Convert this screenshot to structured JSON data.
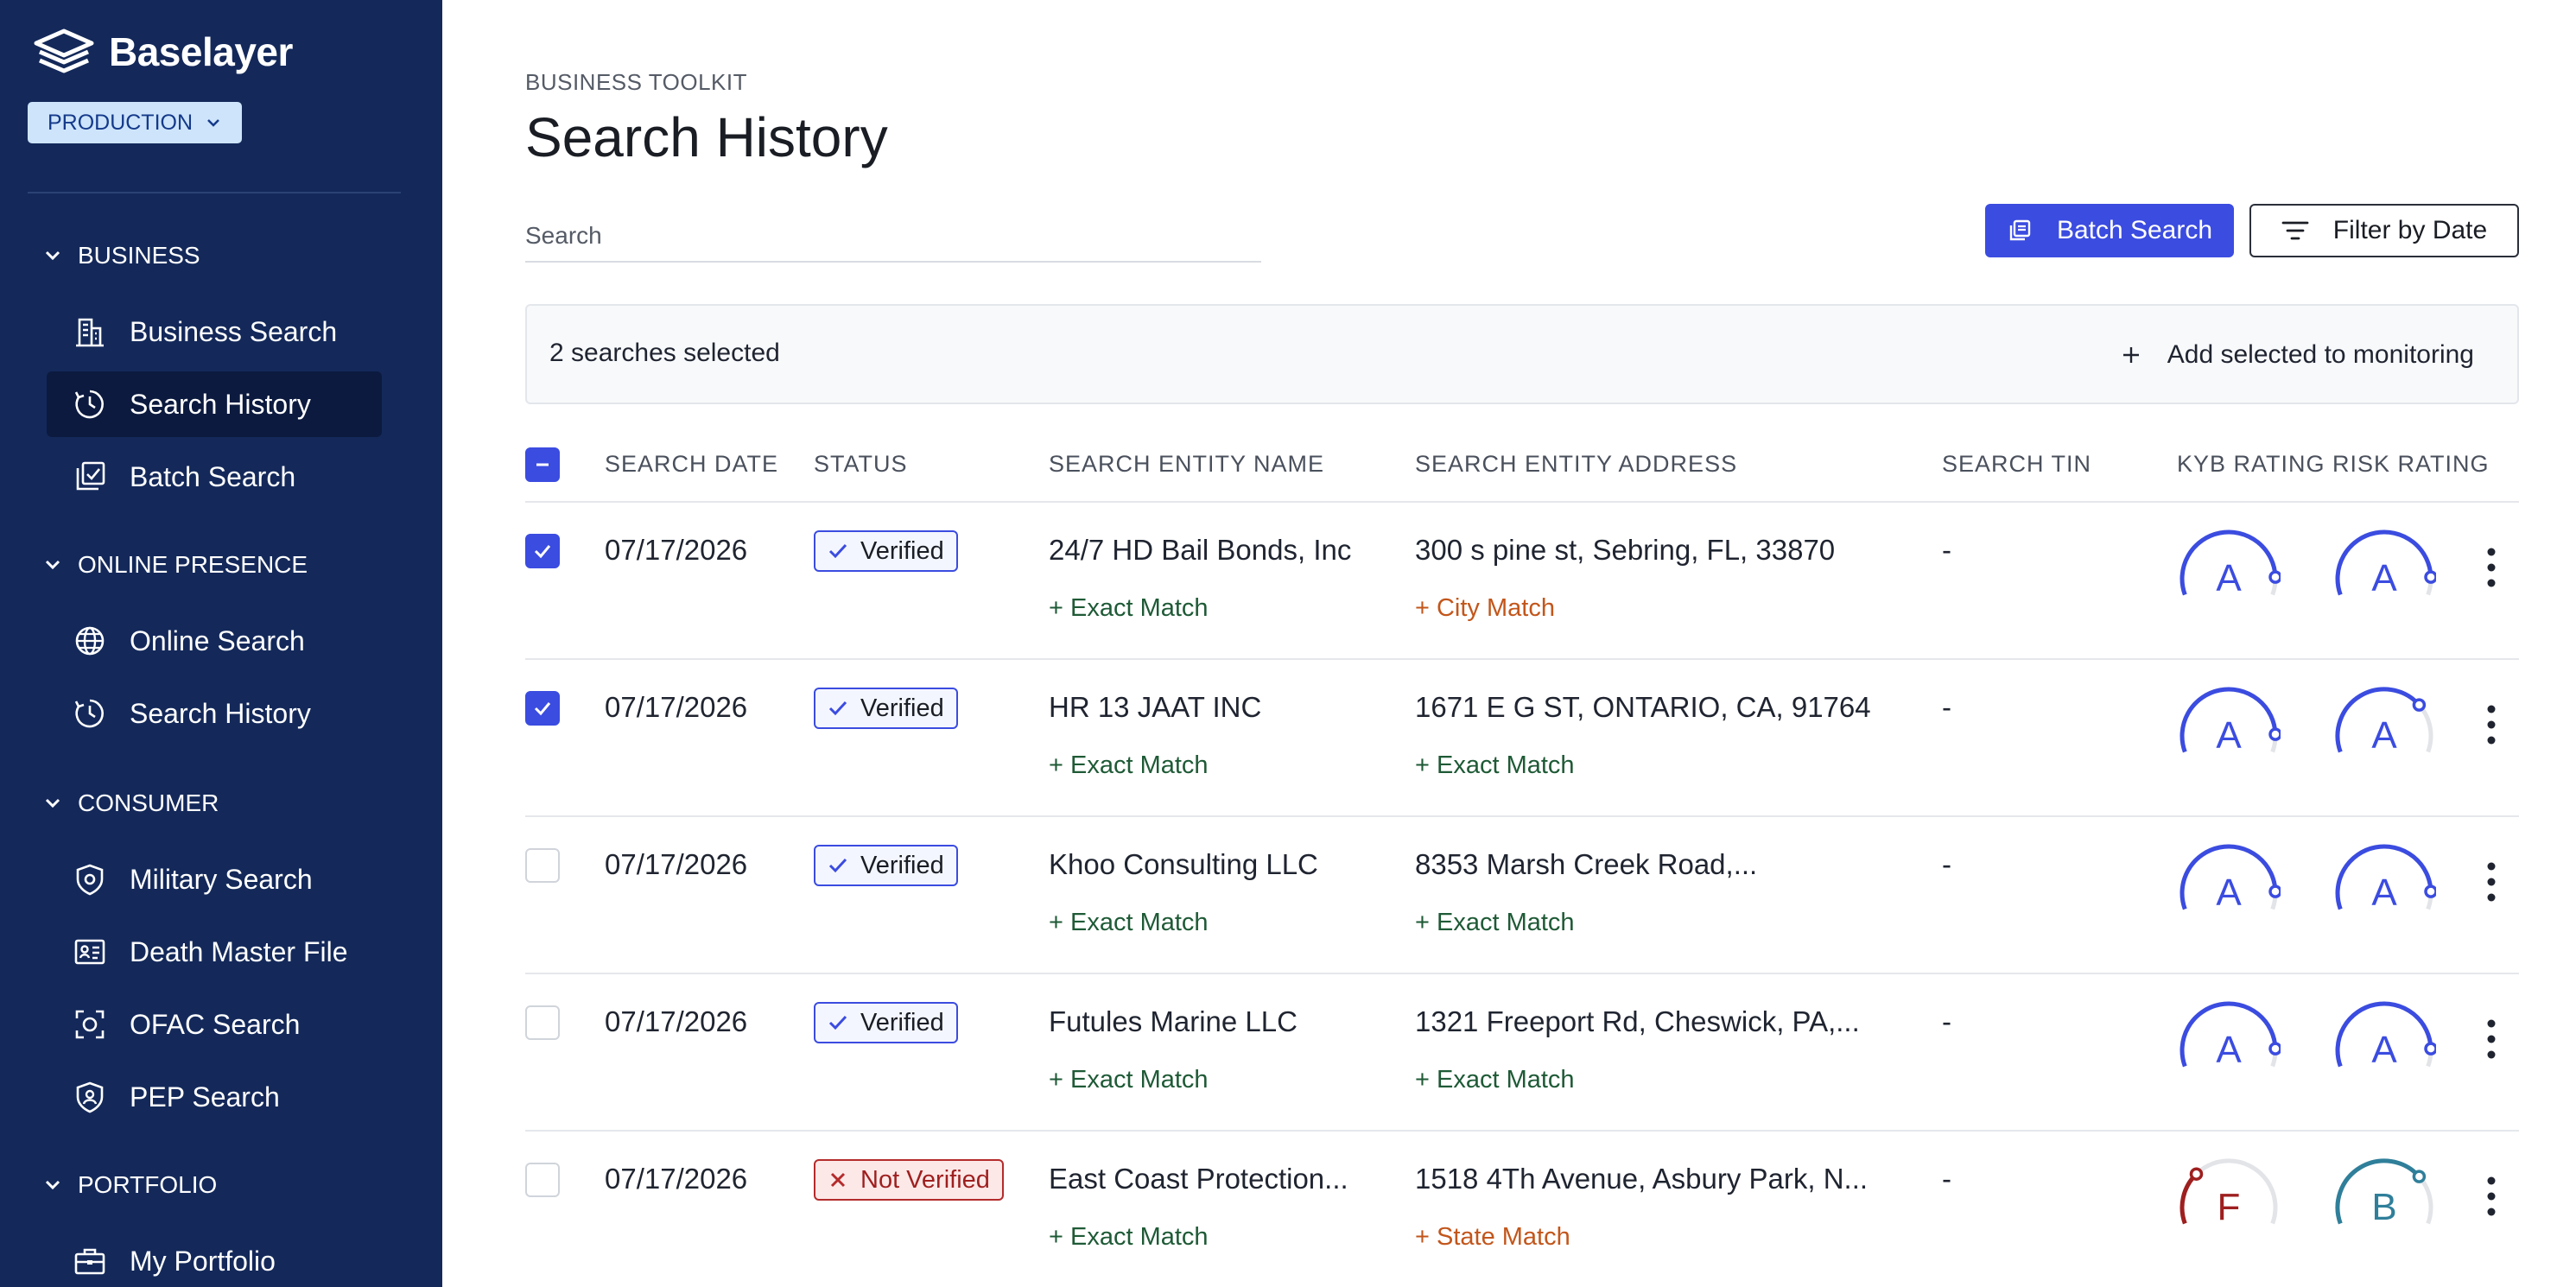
{
  "sidebar": {
    "brand": "Baselayer",
    "environment": "PRODUCTION",
    "sections": [
      {
        "title": "BUSINESS",
        "items": [
          {
            "label": "Business Search",
            "icon": "building-icon"
          },
          {
            "label": "Search History",
            "icon": "clock-history-icon",
            "active": true
          },
          {
            "label": "Batch Search",
            "icon": "batch-icon"
          }
        ]
      },
      {
        "title": "ONLINE PRESENCE",
        "items": [
          {
            "label": "Online Search",
            "icon": "globe-icon"
          },
          {
            "label": "Search History",
            "icon": "clock-history-icon"
          }
        ]
      },
      {
        "title": "CONSUMER",
        "items": [
          {
            "label": "Military Search",
            "icon": "shield-icon"
          },
          {
            "label": "Death Master File",
            "icon": "id-card-icon"
          },
          {
            "label": "OFAC Search",
            "icon": "scan-icon"
          },
          {
            "label": "PEP Search",
            "icon": "person-shield-icon"
          }
        ]
      },
      {
        "title": "PORTFOLIO",
        "items": [
          {
            "label": "My Portfolio",
            "icon": "briefcase-icon"
          }
        ]
      }
    ]
  },
  "header": {
    "breadcrumb": "BUSINESS TOOLKIT",
    "title": "Search History"
  },
  "toolbar": {
    "search_placeholder": "Search",
    "batch_search_label": "Batch Search",
    "filter_label": "Filter by Date"
  },
  "selection": {
    "count_text": "2 searches selected",
    "add_label": "Add selected to monitoring"
  },
  "table": {
    "columns": [
      "SEARCH DATE",
      "STATUS",
      "SEARCH ENTITY NAME",
      "SEARCH ENTITY ADDRESS",
      "SEARCH TIN",
      "KYB RATING",
      "RISK RATING"
    ],
    "rows": [
      {
        "checked": true,
        "date": "07/17/2026",
        "status": "Verified",
        "status_type": "verified",
        "name": "24/7 HD Bail Bonds, Inc",
        "name_match": "Exact Match",
        "name_match_type": "exact",
        "address": "300 s pine st, Sebring, FL, 33870",
        "address_match": "City Match",
        "address_match_type": "warn",
        "tin": "-",
        "kyb": "A",
        "kyb_level": 0.9,
        "risk": "A",
        "risk_level": 0.9
      },
      {
        "checked": true,
        "date": "07/17/2026",
        "status": "Verified",
        "status_type": "verified",
        "name": "HR 13 JAAT INC",
        "name_match": "Exact Match",
        "name_match_type": "exact",
        "address": "1671 E G ST, ONTARIO, CA, 91764",
        "address_match": "Exact Match",
        "address_match_type": "exact",
        "tin": "-",
        "kyb": "A",
        "kyb_level": 0.9,
        "risk": "A",
        "risk_level": 0.72
      },
      {
        "checked": false,
        "date": "07/17/2026",
        "status": "Verified",
        "status_type": "verified",
        "name": "Khoo Consulting LLC",
        "name_match": "Exact Match",
        "name_match_type": "exact",
        "address": "8353 Marsh Creek Road,...",
        "address_match": "Exact Match",
        "address_match_type": "exact",
        "tin": "-",
        "kyb": "A",
        "kyb_level": 0.9,
        "risk": "A",
        "risk_level": 0.9
      },
      {
        "checked": false,
        "date": "07/17/2026",
        "status": "Verified",
        "status_type": "verified",
        "name": "Futules Marine LLC",
        "name_match": "Exact Match",
        "name_match_type": "exact",
        "address": "1321 Freeport Rd, Cheswick, PA,...",
        "address_match": "Exact Match",
        "address_match_type": "exact",
        "tin": "-",
        "kyb": "A",
        "kyb_level": 0.9,
        "risk": "A",
        "risk_level": 0.9
      },
      {
        "checked": false,
        "date": "07/17/2026",
        "status": "Not Verified",
        "status_type": "not-verified",
        "name": "East Coast Protection...",
        "name_match": "Exact Match",
        "name_match_type": "exact",
        "address": "1518 4Th Avenue, Asbury Park, N...",
        "address_match": "State Match",
        "address_match_type": "warn",
        "tin": "-",
        "kyb": "F",
        "kyb_level": 0.3,
        "risk": "B",
        "risk_level": 0.72
      }
    ]
  },
  "colors": {
    "sidebar_bg": "#14295a",
    "accent": "#3b4ce0",
    "grade_a": "#3b4ce0",
    "grade_b": "#2f7f9a",
    "grade_f": "#9e1f1f",
    "track": "#e2e4e8"
  }
}
